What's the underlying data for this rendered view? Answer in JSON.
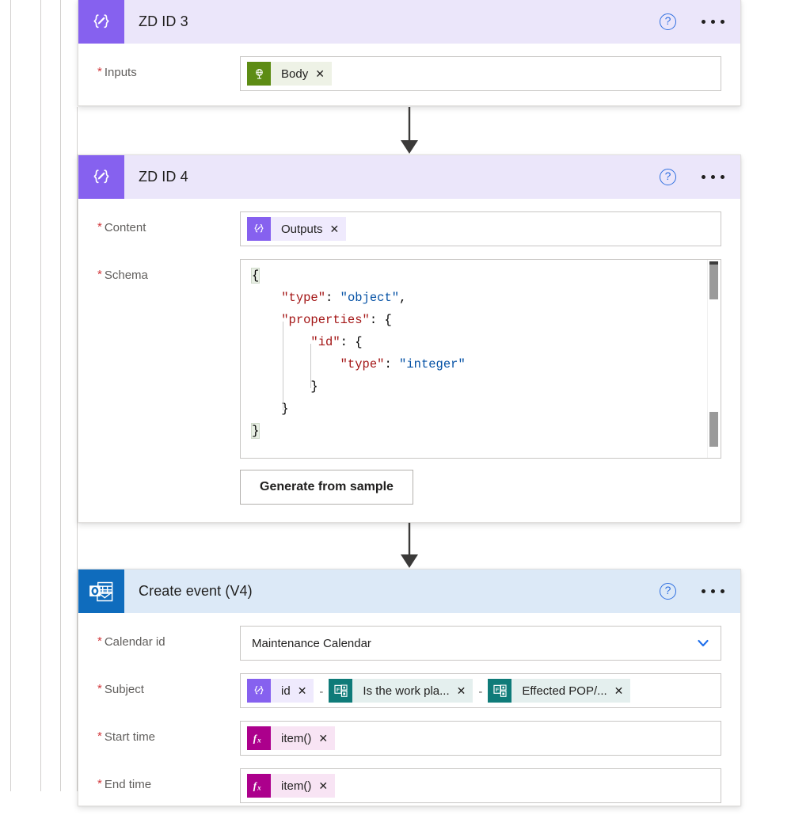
{
  "scope_lines": [
    13,
    51,
    76,
    97
  ],
  "colors": {
    "purple_accent": "#8661ef",
    "purple_header": "#ebe6fa",
    "blue_accent": "#0f6cbd",
    "blue_header": "#dce9f7",
    "green_token": "#5d8c14",
    "teal_token": "#0f7b79",
    "magenta_token": "#ac008c",
    "required_red": "#d13438",
    "link_blue": "#2f6fe0"
  },
  "cards": [
    {
      "title": "ZD ID 3",
      "icon": "data-operation-compose-icon",
      "help_label": "?",
      "more_label": "more-commands"
    },
    {
      "title": "ZD ID 4",
      "icon": "data-operation-parse-json-icon",
      "help_label": "?",
      "more_label": "more-commands"
    },
    {
      "title": "Create event (V4)",
      "icon": "outlook-icon",
      "help_label": "?",
      "more_label": "more-commands"
    }
  ],
  "card1": {
    "title": "ZD ID 3",
    "inputs_label": "Inputs",
    "inputs_token": {
      "label": "Body",
      "icon": "http-connector-icon",
      "remove": "✕"
    }
  },
  "card2": {
    "title": "ZD ID 4",
    "content_label": "Content",
    "content_token": {
      "label": "Outputs",
      "icon": "compose-icon",
      "remove": "✕"
    },
    "schema_label": "Schema",
    "schema_lines": [
      "{",
      "    \"type\": \"object\",",
      "    \"properties\": {",
      "        \"id\": {",
      "            \"type\": \"integer\"",
      "        }",
      "    }",
      "}"
    ],
    "schema_text": "{\n    \"type\": \"object\",\n    \"properties\": {\n        \"id\": {\n            \"type\": \"integer\"\n        }\n    }\n}",
    "generate_button": "Generate from sample"
  },
  "card3": {
    "title": "Create event (V4)",
    "calendar_label": "Calendar id",
    "calendar_value": "Maintenance Calendar",
    "subject_label": "Subject",
    "subject_tokens": [
      {
        "label": "id",
        "icon": "compose-icon",
        "color": "purple",
        "remove": "✕"
      },
      {
        "label": "Is the work pla...",
        "icon": "forms-icon",
        "color": "teal",
        "remove": "✕"
      },
      {
        "label": "Effected POP/...",
        "icon": "forms-icon",
        "color": "teal",
        "remove": "✕"
      }
    ],
    "subject_separator": "-",
    "start_label": "Start time",
    "start_token": {
      "label": "item()",
      "icon": "expression-fx-icon",
      "remove": "✕"
    },
    "end_label": "End time",
    "end_token": {
      "label": "item()",
      "icon": "expression-fx-icon",
      "remove": "✕"
    }
  }
}
